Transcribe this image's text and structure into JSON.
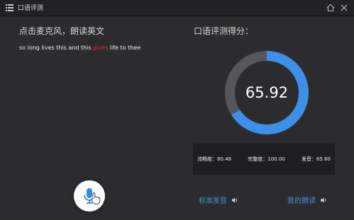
{
  "window": {
    "title": "口语评测"
  },
  "left": {
    "instruction": "点击麦克风，朗读英文",
    "sentence": {
      "before": "so long lives this and this ",
      "highlight": "gives",
      "after": " life to thee"
    },
    "highlight_color": "#e0302a"
  },
  "right": {
    "score_title": "口语评测得分：",
    "score": 65.92,
    "score_text": "65.92",
    "ring_color": "#3d8fe8",
    "ring_track_color": "#55575a",
    "metrics": {
      "fluency": "流畅度：80.48",
      "completeness": "完整度：100.00",
      "pronunciation": "发音：65.60"
    }
  },
  "actions": {
    "standard_label": "标准发音",
    "mine_label": "我的朗读",
    "link_color": "#3d8fe8"
  },
  "icons": {
    "app": "list-icon",
    "home": "home-icon",
    "close": "close-icon",
    "mic": "microphone-icon",
    "cursor": "hand-pointer-icon",
    "speaker": "speaker-icon"
  }
}
